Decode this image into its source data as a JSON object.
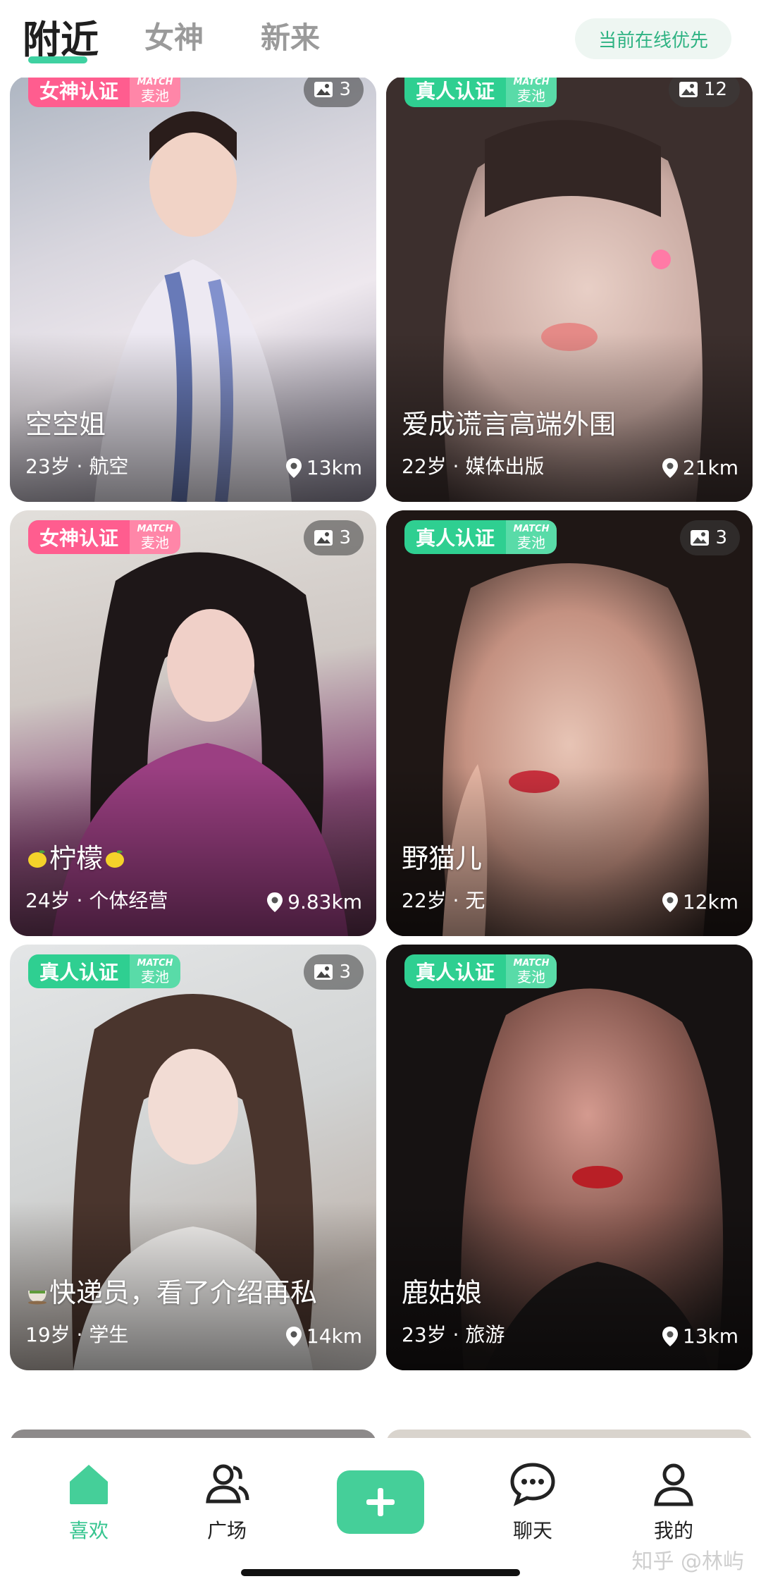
{
  "top_tabs": {
    "nearby": "附近",
    "goddess": "女神",
    "newcomer": "新来",
    "online_first": "当前在线优先"
  },
  "badges": {
    "goddess": "女神认证",
    "real": "真人认证",
    "match_top": "MATCH",
    "match_bottom": "麦池"
  },
  "cards": [
    {
      "badge_type": "goddess",
      "photo_count": "3",
      "name": "空空姐",
      "meta": "23岁 · 航空",
      "distance": "13km",
      "colors": [
        "#c9c8d4",
        "#8f94a3",
        "#e7e2ea"
      ]
    },
    {
      "badge_type": "real",
      "photo_count": "12",
      "name": "爱成谎言高端外围",
      "meta": "22岁 · 媒体出版",
      "distance": "21km",
      "colors": [
        "#b49b95",
        "#e5c9c1",
        "#5a4744"
      ]
    },
    {
      "badge_type": "goddess",
      "photo_count": "3",
      "name": "柠檬",
      "meta": "24岁 · 个体经营",
      "distance": "9.83km",
      "colors": [
        "#d9d6d2",
        "#9a4a7d",
        "#2d2426"
      ]
    },
    {
      "badge_type": "real",
      "photo_count": "3",
      "name": "野猫儿",
      "meta": "22岁 · 无",
      "distance": "12km",
      "colors": [
        "#3a2a24",
        "#d9b6a6",
        "#231a18"
      ]
    },
    {
      "badge_type": "real",
      "photo_count": "3",
      "name": "快递员，看了介绍再私",
      "meta": "19岁 · 学生",
      "distance": "14km",
      "colors": [
        "#d8dadb",
        "#c3b3aa",
        "#5b463d"
      ]
    },
    {
      "badge_type": "real",
      "photo_count": "",
      "name": "鹿姑娘",
      "meta": "23岁 · 旅游",
      "distance": "13km",
      "colors": [
        "#2a2322",
        "#c38a80",
        "#1a1515"
      ]
    }
  ],
  "bottom_nav": {
    "like": "喜欢",
    "square": "广场",
    "chat": "聊天",
    "me": "我的",
    "accent": "#45cf99"
  },
  "watermark": "知乎 @林屿"
}
